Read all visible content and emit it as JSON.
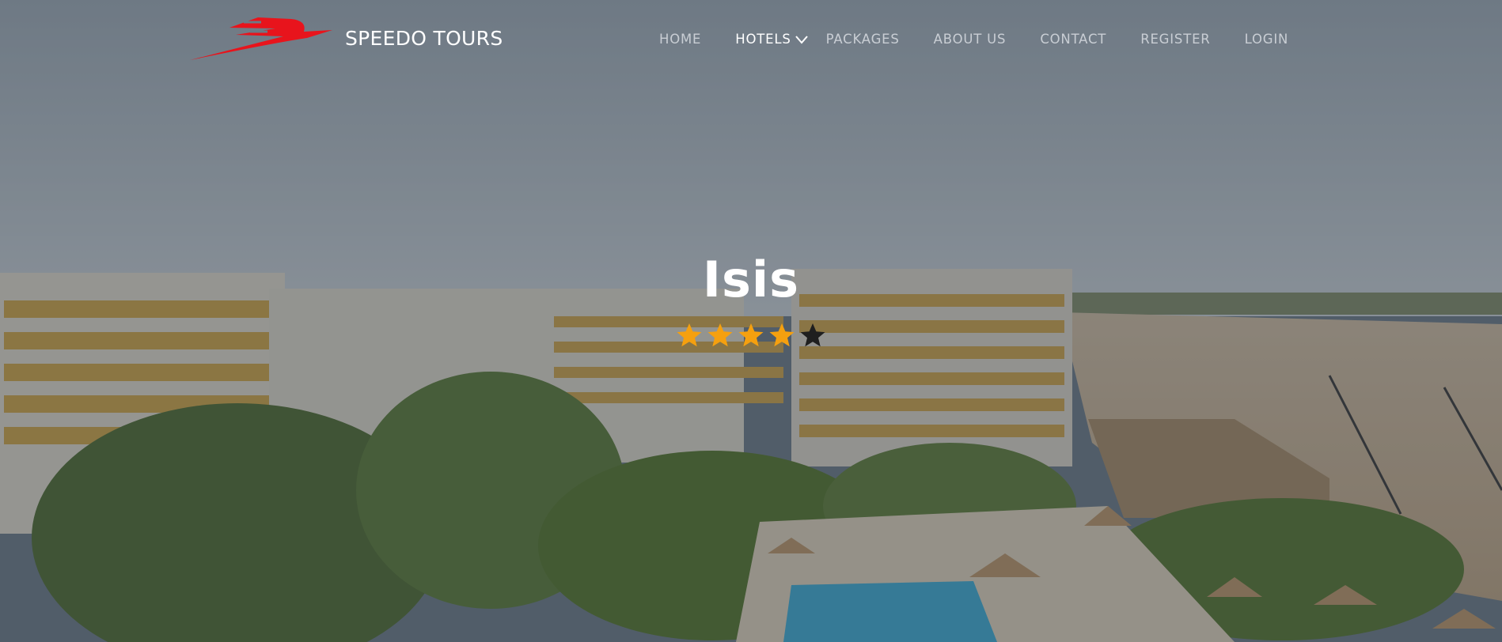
{
  "brand": {
    "name": "SPEEDO TOURS",
    "logo_icon": "speed-swoosh-logo-icon",
    "logo_color": "#e8141c"
  },
  "nav": {
    "items": [
      {
        "label": "HOME",
        "active": false
      },
      {
        "label": "HOTELS",
        "active": true,
        "dropdown": true
      },
      {
        "label": "PACKAGES",
        "active": false
      },
      {
        "label": "ABOUT US",
        "active": false
      },
      {
        "label": "CONTACT",
        "active": false
      },
      {
        "label": "REGISTER",
        "active": false
      },
      {
        "label": "LOGIN",
        "active": false
      }
    ],
    "dropdown_icon": "chevron-down-icon"
  },
  "hero": {
    "title": "Isis",
    "rating": {
      "filled": 4,
      "total": 5,
      "filled_color": "#f5a00f",
      "empty_color": "#1f1f1f"
    }
  }
}
